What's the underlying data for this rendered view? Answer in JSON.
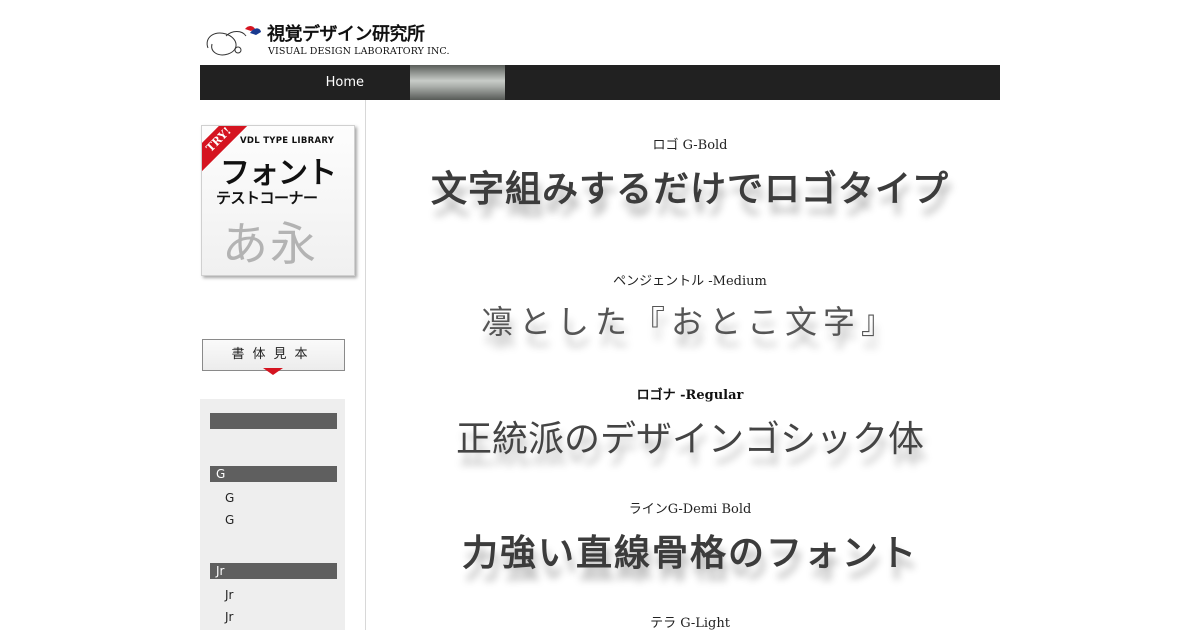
{
  "header": {
    "logo_jp": "視覚デザイン研究所",
    "logo_en": "VISUAL DESIGN LABORATORY INC."
  },
  "nav": {
    "home_label": "Home"
  },
  "banner": {
    "try_label": "TRY!",
    "library_label": "VDL TYPE LIBRARY",
    "title": "フォント",
    "subtitle": "テストコーナー",
    "sample_glyphs": "あ永"
  },
  "sidebar": {
    "sample_button_label": "書体見本",
    "groups": [
      {
        "heading": "",
        "items": []
      },
      {
        "heading": "G",
        "items": [
          "G",
          "G"
        ]
      },
      {
        "heading": "Jr",
        "items": [
          "Jr",
          "Jr"
        ]
      }
    ]
  },
  "samples": [
    {
      "font_name": "ロゴ G-Bold",
      "text": "文字組みするだけでロゴタイプ"
    },
    {
      "font_name": "ペンジェントル -Medium",
      "text": "凛とした『おとこ文字』"
    },
    {
      "font_name": "ロゴナ -Regular",
      "text": "正統派のデザインゴシック体"
    },
    {
      "font_name": "ラインG-Demi Bold",
      "text": "力強い直線骨格のフォント"
    },
    {
      "font_name": "テラ G-Light",
      "text": ""
    }
  ],
  "colors": {
    "nav_bg": "#212121",
    "accent_red": "#d51420",
    "sidebar_bg": "#eeeeee",
    "sidebar_heading_bg": "#5f5f5f"
  }
}
